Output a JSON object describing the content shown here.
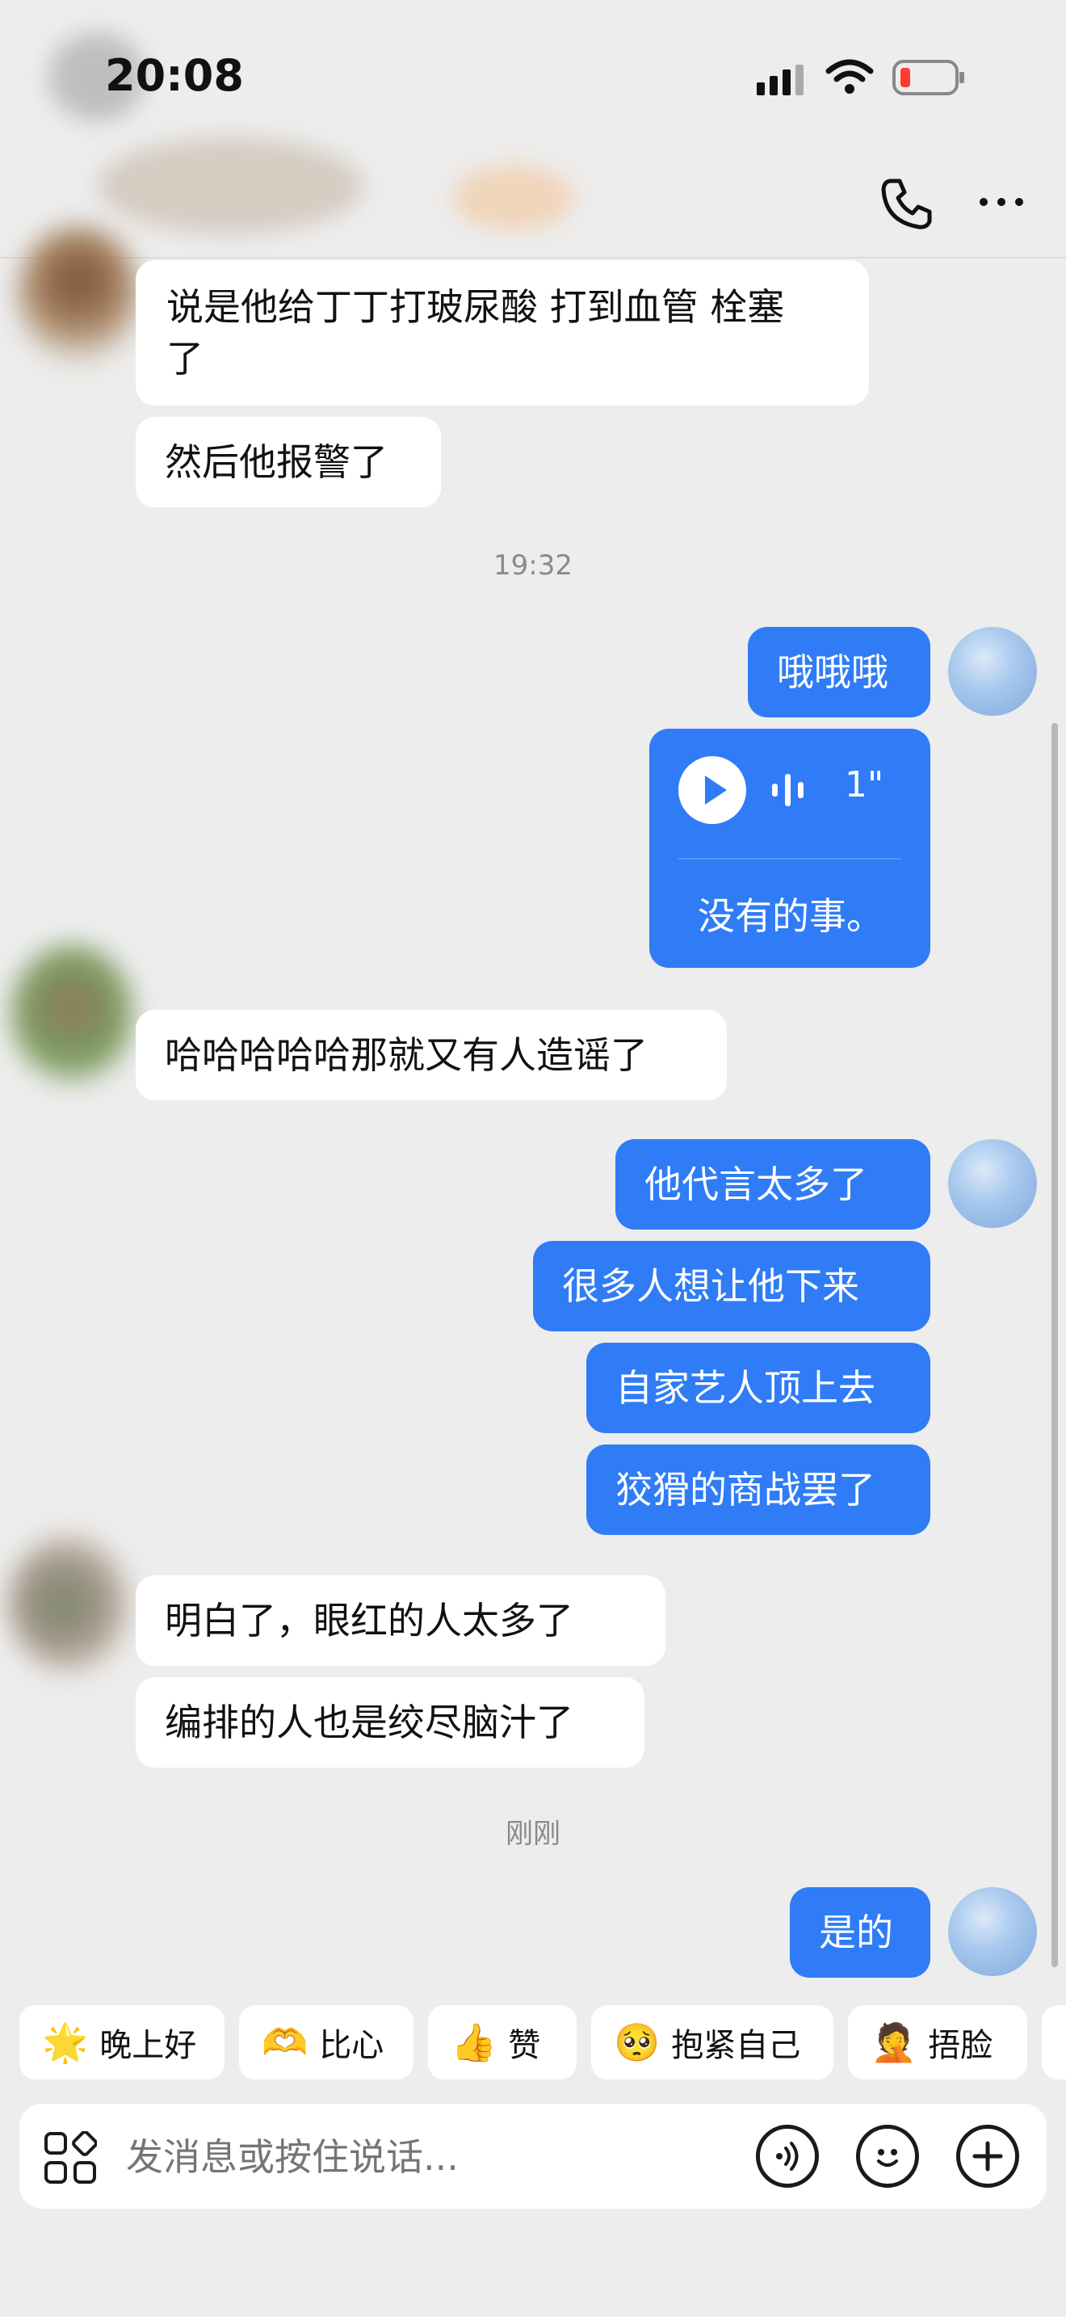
{
  "status_bar": {
    "time": "20:08"
  },
  "messages": {
    "m1": "说是他给丁丁打玻尿酸 打到血管 栓塞",
    "m1b": "了",
    "m2": "然后他报警了",
    "ts1": "19:32",
    "m3": "哦哦哦",
    "voice_duration": "1\"",
    "voice_text": "没有的事。",
    "m4": "哈哈哈哈哈那就又有人造谣了",
    "m5": "他代言太多了",
    "m6": "很多人想让他下来",
    "m7": "自家艺人顶上去",
    "m8": "狡猾的商战罢了",
    "m9": "明白了，眼红的人太多了",
    "m10": "编排的人也是绞尽脑汁了",
    "ts2": "刚刚",
    "m11": "是的"
  },
  "quick_replies": [
    {
      "label": "晚上好",
      "icon": "star-face-icon"
    },
    {
      "label": "比心",
      "icon": "heart-hands-icon"
    },
    {
      "label": "赞",
      "icon": "thumbs-up-icon"
    },
    {
      "label": "抱紧自己",
      "icon": "hug-self-icon"
    },
    {
      "label": "捂脸",
      "icon": "facepalm-icon"
    }
  ],
  "input": {
    "placeholder": "发消息或按住说话..."
  }
}
